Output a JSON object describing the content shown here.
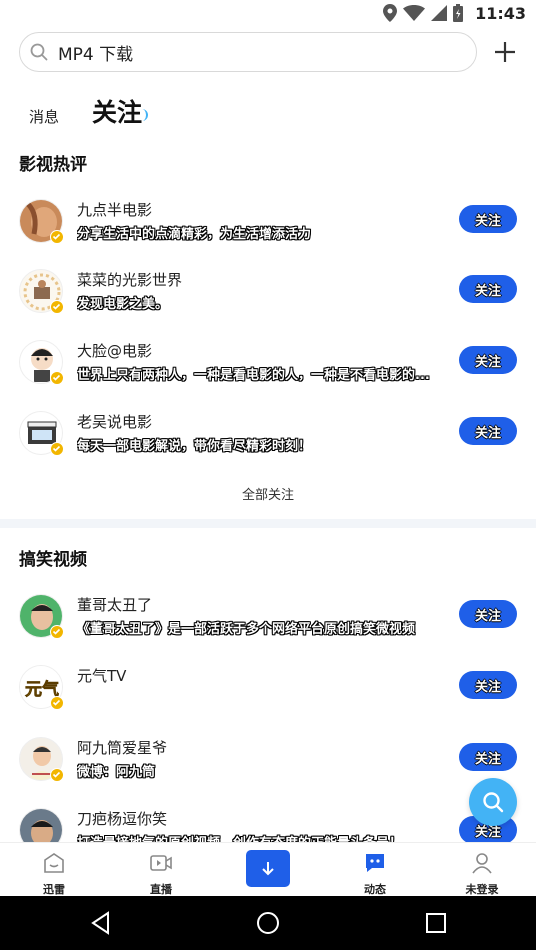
{
  "status_bar": {
    "time": "11:43"
  },
  "search": {
    "text": "MP4 下载"
  },
  "tabs": {
    "messages": "消息",
    "following": "关注"
  },
  "sections": [
    {
      "title": "影视热评",
      "items": [
        {
          "name": "九点半电影",
          "desc": "分享生活中的点滴精彩，为生活增添活力",
          "button": "关注"
        },
        {
          "name": "菜菜的光影世界",
          "desc": "发现电影之美。",
          "button": "关注"
        },
        {
          "name": "大脸@电影",
          "desc": "世界上只有两种人，一种是看电影的人，一种是不看电影的...",
          "button": "关注"
        },
        {
          "name": "老吴说电影",
          "desc": "每天一部电影解说，带你看尽精彩时刻！",
          "button": "关注"
        }
      ],
      "footer": "全部关注"
    },
    {
      "title": "搞笑视频",
      "items": [
        {
          "name": "董哥太丑了",
          "desc": "《董哥太丑了》是一部活跃于多个网络平台原创搞笑微视频",
          "button": "关注"
        },
        {
          "name": "元气TV",
          "desc": "",
          "button": "关注",
          "avatar_text": "元气"
        },
        {
          "name": "阿九筒爱星爷",
          "desc": "微博：阿九筒",
          "button": "关注"
        },
        {
          "name": "刀疤杨逗你笑",
          "desc": "打造最接地气的原创视频，创作有态度的正能量头条号！",
          "button": "关注"
        }
      ]
    }
  ],
  "bottom_nav": {
    "items": [
      {
        "label": "迅雷",
        "icon": "home-box-icon"
      },
      {
        "label": "直播",
        "icon": "live-video-icon"
      },
      {
        "label": "",
        "icon": "download-arrow-icon"
      },
      {
        "label": "动态",
        "icon": "chat-bubble-icon"
      },
      {
        "label": "未登录",
        "icon": "user-icon"
      }
    ]
  },
  "colors": {
    "accent": "#1f5fe8",
    "fab": "#43b3f5",
    "badge": "#f2b600",
    "divider": "#f2f5f9"
  }
}
